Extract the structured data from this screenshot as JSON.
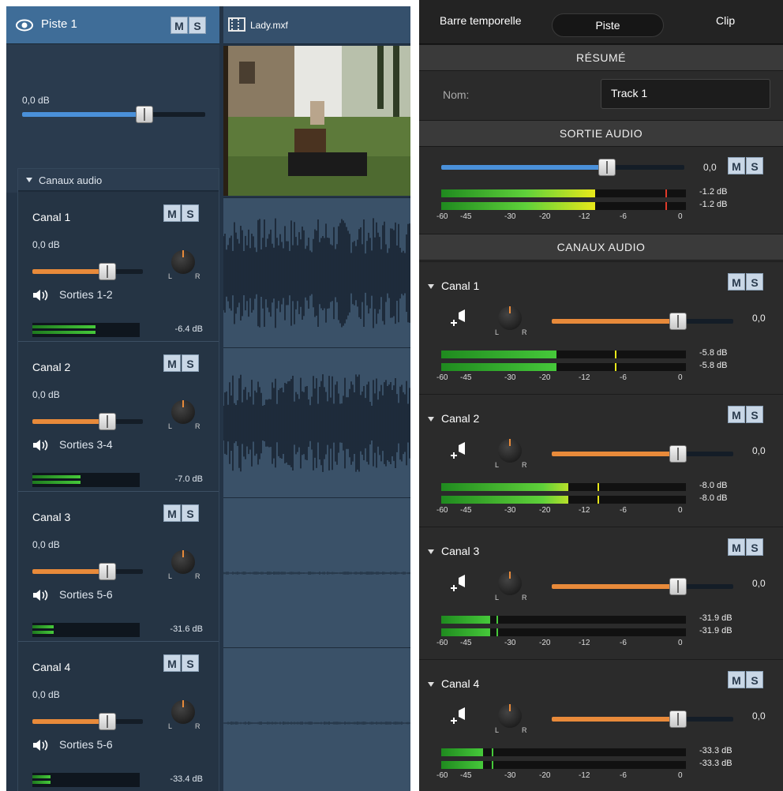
{
  "track": {
    "name": "Piste 1",
    "mute": "M",
    "solo": "S",
    "gain": "0,0 dB",
    "gain_level": 0.67
  },
  "clip": {
    "name": "Lady.mxf"
  },
  "channels_panel": {
    "title": "Canaux audio"
  },
  "left_channels": [
    {
      "name": "Canal 1",
      "gain": "0,0 dB",
      "outputs": "Sorties 1-2",
      "level": "-6.4 dB",
      "meter": 0.59
    },
    {
      "name": "Canal 2",
      "gain": "0,0 dB",
      "outputs": "Sorties 3-4",
      "level": "-7.0 dB",
      "meter": 0.45
    },
    {
      "name": "Canal 3",
      "gain": "0,0 dB",
      "outputs": "Sorties 5-6",
      "level": "-31.6 dB",
      "meter": 0.2
    },
    {
      "name": "Canal 4",
      "gain": "0,0 dB",
      "outputs": "Sorties 5-6",
      "level": "-33.4 dB",
      "meter": 0.17
    }
  ],
  "inspector": {
    "tabs": [
      "Barre temporelle",
      "Piste",
      "Clip"
    ],
    "active_tab": "Piste",
    "summary_title": "RÉSUMÉ",
    "name_label": "Nom:",
    "name_value": "Track 1",
    "audio_out_title": "SORTIE AUDIO",
    "audio_out_value": "0,0",
    "audio_out_levels": [
      "-1.2 dB",
      "-1.2 dB"
    ],
    "audio_out_meter": 0.63,
    "channels_title": "CANAUX AUDIO",
    "scale": [
      "-60",
      "-45",
      "-30",
      "-20",
      "-12",
      "-6",
      "0"
    ],
    "channels": [
      {
        "name": "Canal 1",
        "value": "0,0",
        "levels": [
          "-5.8 dB",
          "-5.8 dB"
        ],
        "meter": 0.47
      },
      {
        "name": "Canal 2",
        "value": "0,0",
        "levels": [
          "-8.0 dB",
          "-8.0 dB"
        ],
        "meter": 0.52
      },
      {
        "name": "Canal 3",
        "value": "0,0",
        "levels": [
          "-31.9 dB",
          "-31.9 dB"
        ],
        "meter": 0.2
      },
      {
        "name": "Canal 4",
        "value": "0,0",
        "levels": [
          "-33.3 dB",
          "-33.3 dB"
        ],
        "meter": 0.17
      }
    ]
  },
  "colors": {
    "track_header": "#3f6d98",
    "blue_slider": "#4a90d9",
    "orange_slider": "#e88a3a",
    "meter_green": "#46c93a",
    "meter_yellow": "#e8e81a"
  }
}
